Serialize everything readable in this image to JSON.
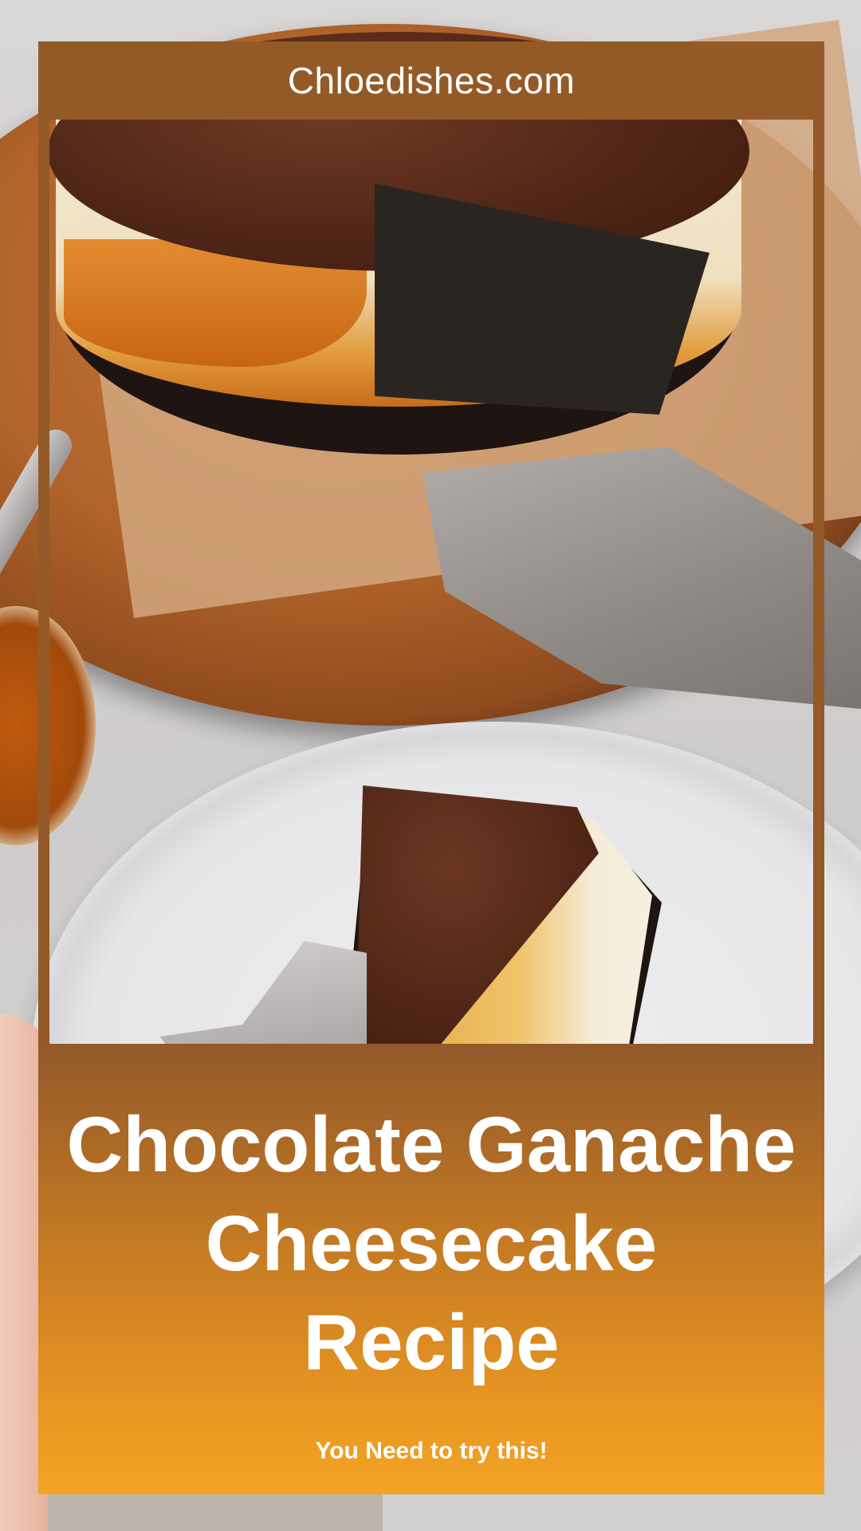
{
  "site": {
    "name": "Chloedishes.com"
  },
  "pin": {
    "title_lines": [
      "Chocolate Ganache",
      "Cheesecake",
      "Recipe"
    ],
    "tagline": "You Need to try this!"
  },
  "colors": {
    "header_bar": "#935a28",
    "panel_gradient_top": "#93592a",
    "panel_gradient_bottom": "#f2a424",
    "text": "#ffffff"
  }
}
